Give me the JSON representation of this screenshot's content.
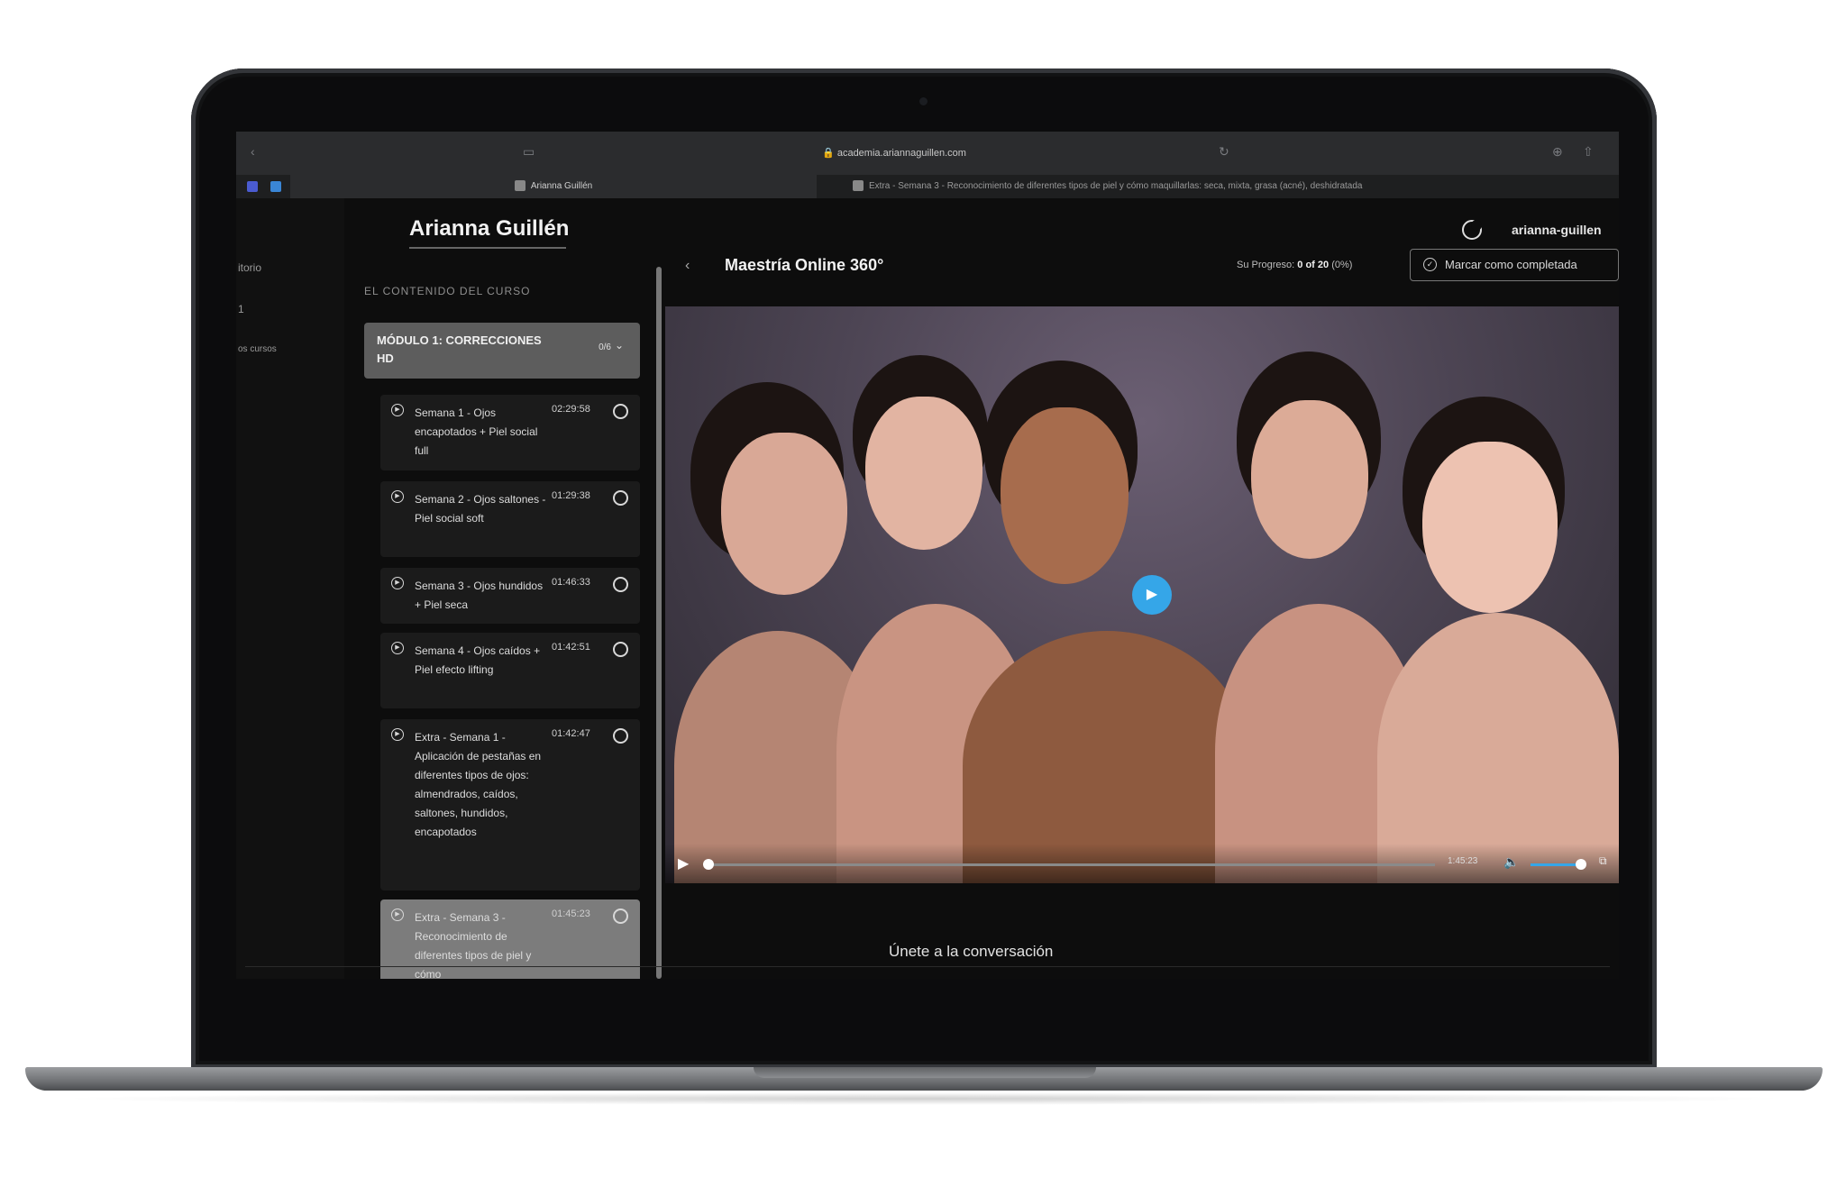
{
  "browser": {
    "url": "academia.ariannaguillen.com",
    "tabs": [
      {
        "label": "Arianna Guillén"
      },
      {
        "label": "Extra - Semana 3 - Reconocimiento de diferentes tipos de piel y cómo maquillarlas: seca, mixta, grasa (acné), deshidratada"
      }
    ]
  },
  "leftnav": {
    "items": [
      "itorio",
      "1",
      "os cursos"
    ]
  },
  "header": {
    "brand": "Arianna Guillén",
    "username": "arianna-guillen"
  },
  "sidebar": {
    "title": "EL CONTENIDO DEL CURSO",
    "module": {
      "title": "MÓDULO 1: CORRECCIONES HD",
      "count": "0/6"
    },
    "lessons": [
      {
        "title": "Semana 1 - Ojos encapotados + Piel social full",
        "duration": "02:29:58"
      },
      {
        "title": "Semana 2 - Ojos saltones - Piel social soft",
        "duration": "01:29:38"
      },
      {
        "title": "Semana 3 - Ojos hundidos + Piel seca",
        "duration": "01:46:33"
      },
      {
        "title": "Semana 4 - Ojos caídos + Piel efecto lifting",
        "duration": "01:42:51"
      },
      {
        "title": "Extra - Semana 1 - Aplicación de pestañas en diferentes tipos de ojos: almendrados, caídos, saltones, hundidos, encapotados",
        "duration": "01:42:47"
      },
      {
        "title": "Extra - Semana 3 - Reconocimiento de diferentes tipos de piel y cómo",
        "duration": "01:45:23"
      }
    ]
  },
  "course": {
    "title": "Maestría Online 360°",
    "progress_label": "Su Progreso:",
    "progress_value": "0 of 20",
    "progress_pct": "(0%)",
    "complete_button": "Marcar como completada"
  },
  "video": {
    "time": "1:45:23",
    "progress": 0,
    "volume": 0.85
  },
  "footer": {
    "join": "Únete a la conversación"
  },
  "colors": {
    "accent": "#35a6e8",
    "background": "#0d0d0d",
    "module_bg": "#5d5d5d",
    "lesson_bg": "#1b1b1b",
    "lesson_selected_bg": "#7c7c7c"
  }
}
